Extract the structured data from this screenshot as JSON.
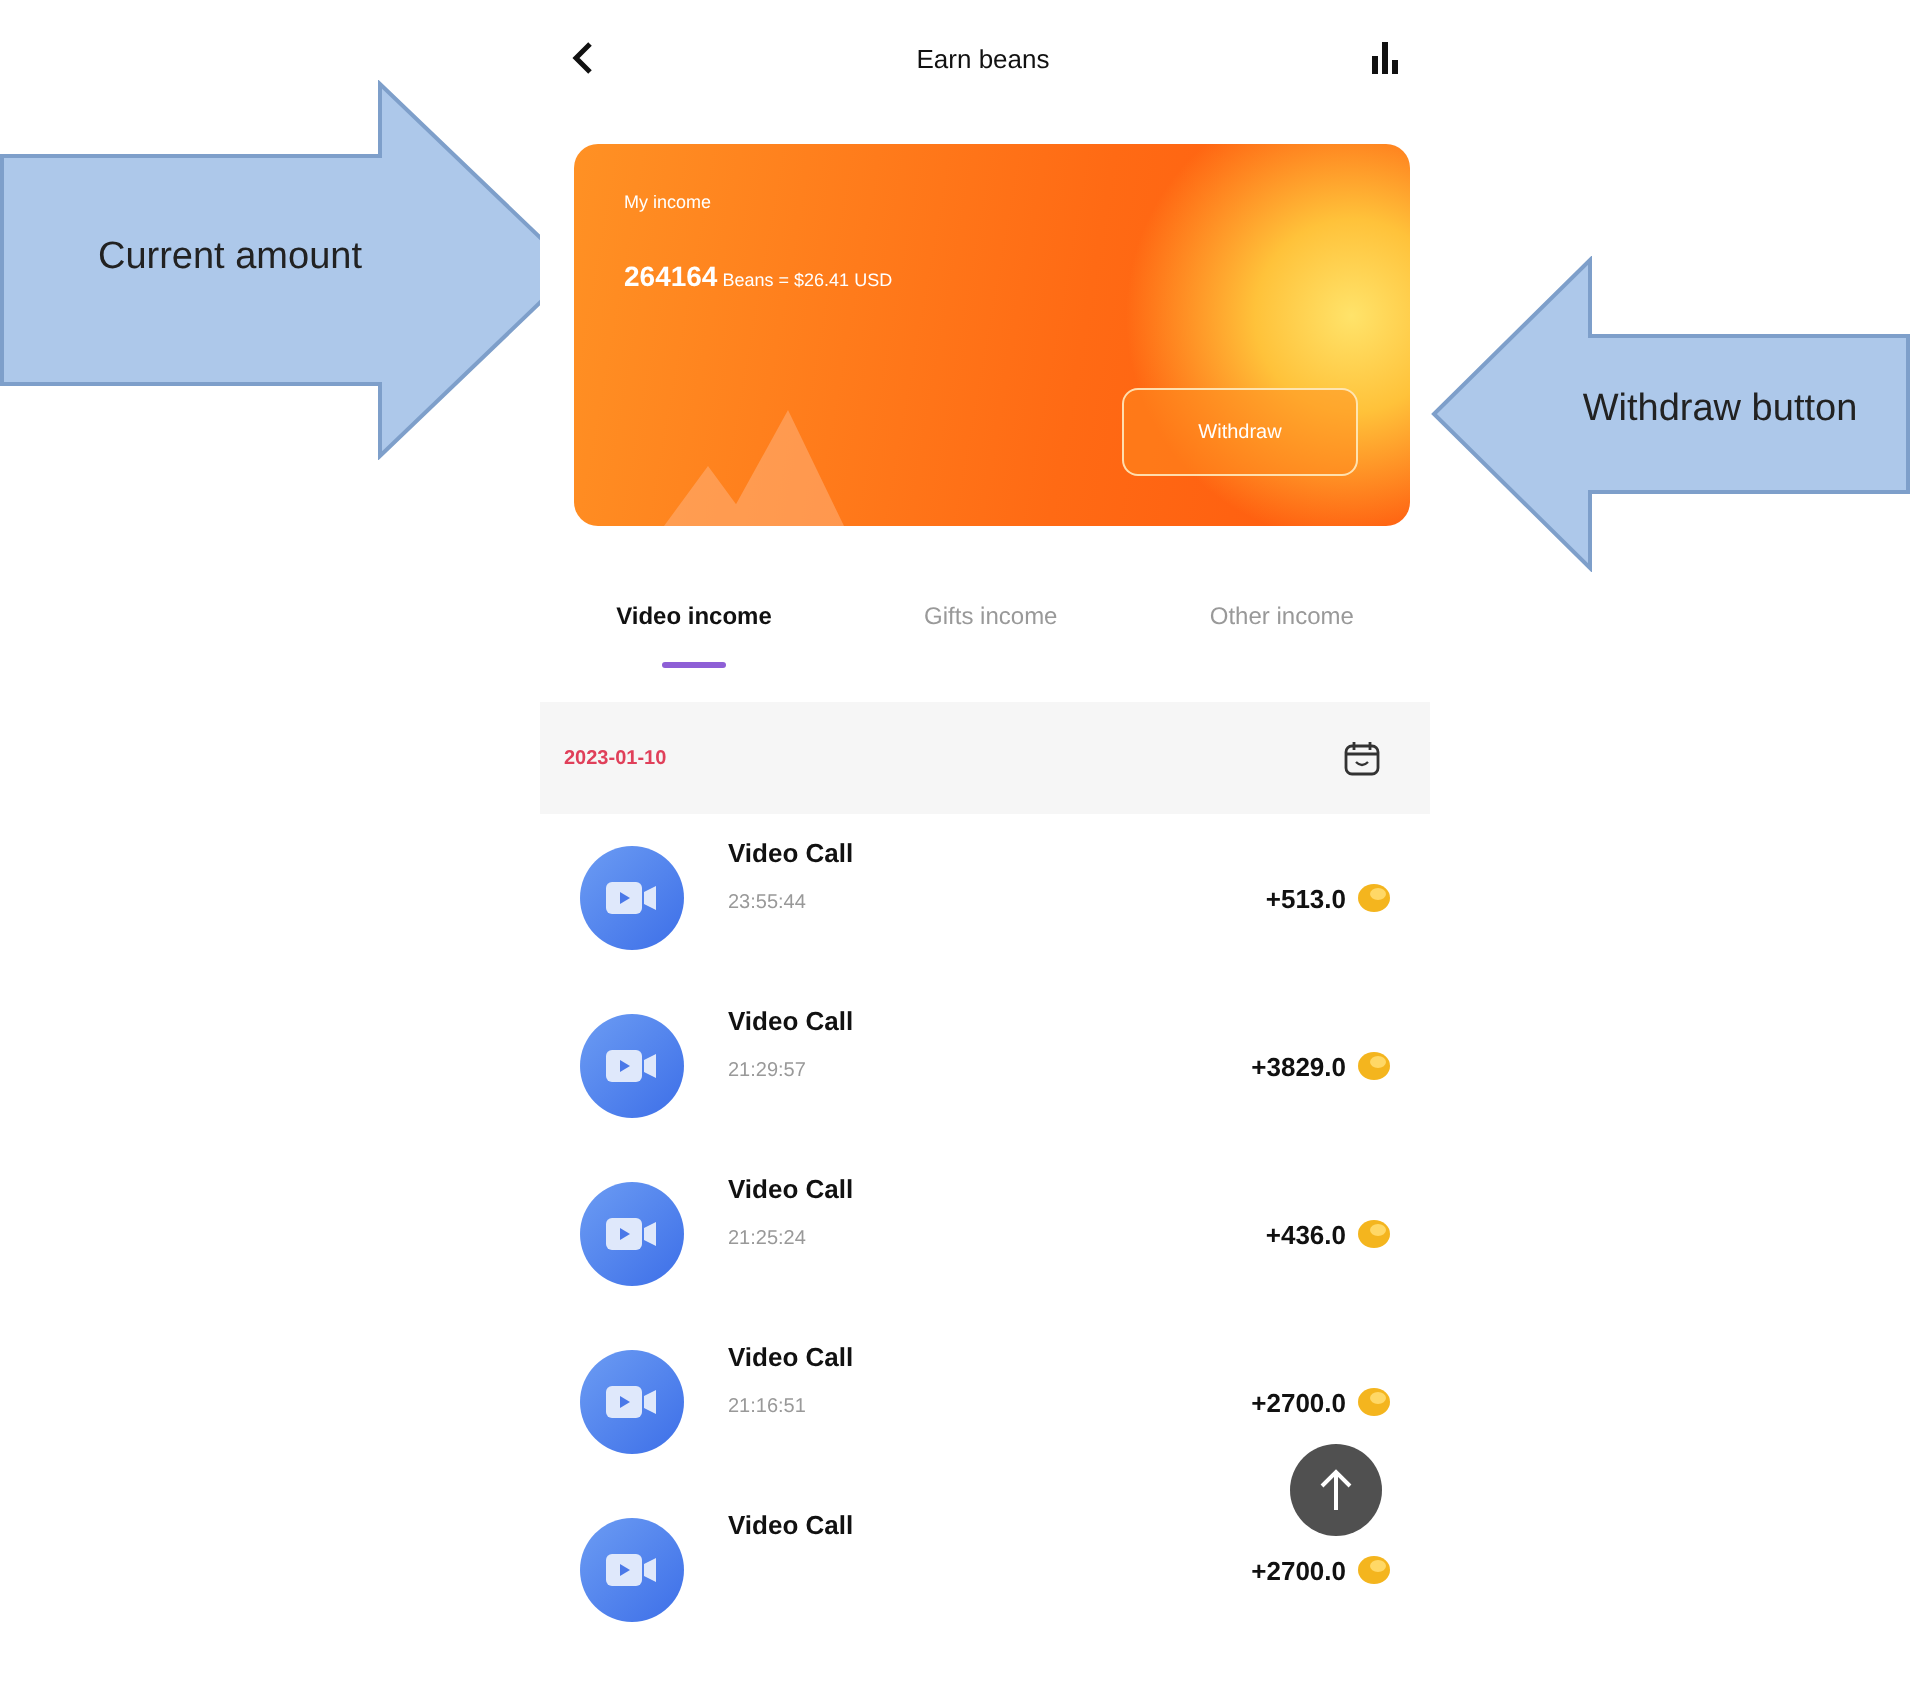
{
  "header": {
    "title": "Earn beans"
  },
  "card": {
    "label": "My income",
    "amount": "264164",
    "unit": "Beans",
    "conversion": "= $26.41 USD",
    "button": "Withdraw"
  },
  "tabs": [
    {
      "label": "Video income",
      "selected": true
    },
    {
      "label": "Gifts income",
      "selected": false
    },
    {
      "label": "Other income",
      "selected": false
    }
  ],
  "date_bar": {
    "date": "2023-01-10"
  },
  "records": [
    {
      "title": "Video Call",
      "time": "23:55:44",
      "amount": "+513.0"
    },
    {
      "title": "Video Call",
      "time": "21:29:57",
      "amount": "+3829.0"
    },
    {
      "title": "Video Call",
      "time": "21:25:24",
      "amount": "+436.0"
    },
    {
      "title": "Video Call",
      "time": "21:16:51",
      "amount": "+2700.0"
    },
    {
      "title": "Video Call",
      "amount": "+2700.0"
    }
  ],
  "annotations": [
    {
      "text": "Current amount",
      "kind": "points_right"
    },
    {
      "text": "Withdraw button",
      "kind": "points_left"
    }
  ]
}
